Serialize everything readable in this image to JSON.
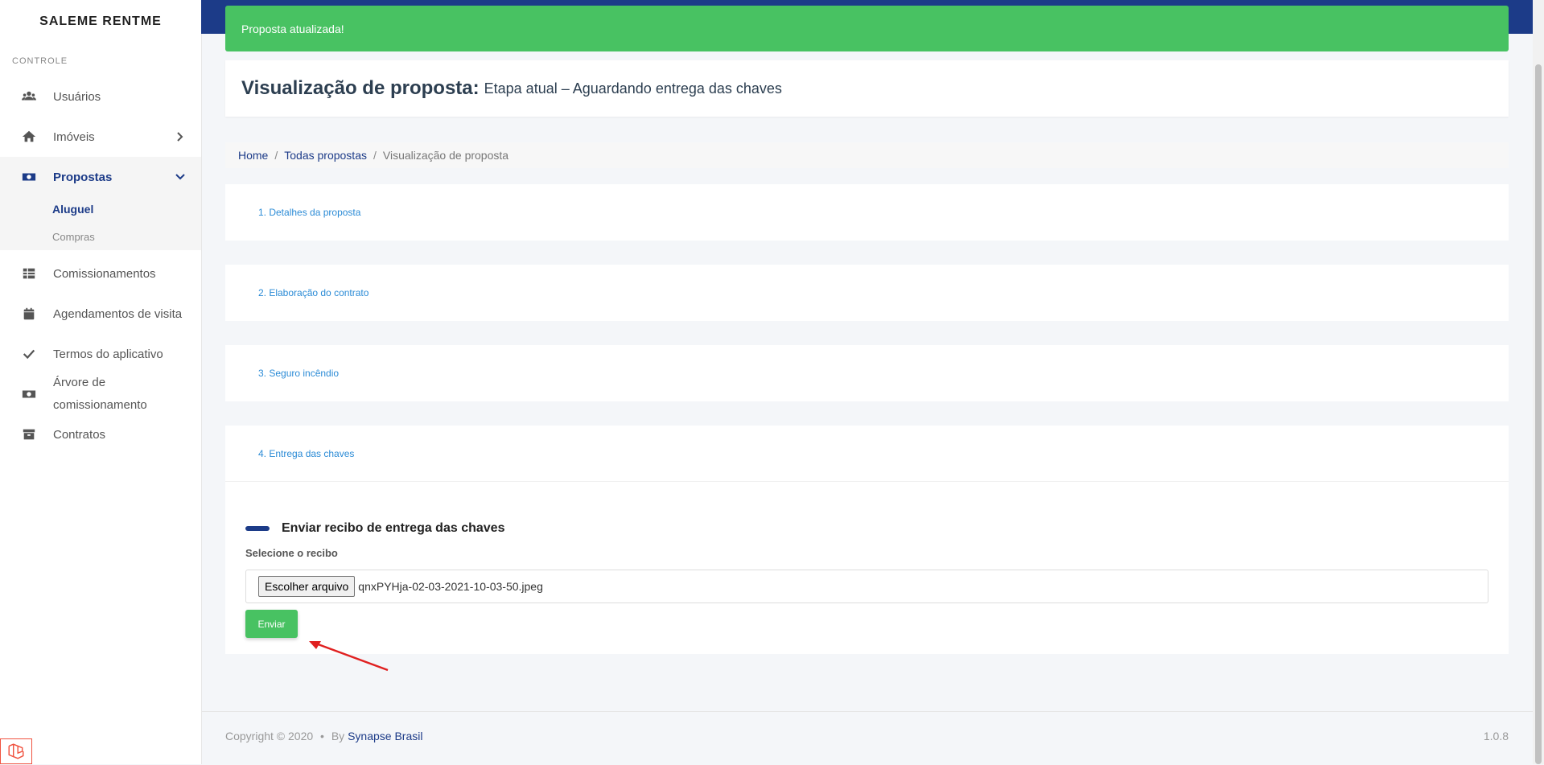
{
  "brand": "SALEME RENTME",
  "sidebar": {
    "section": "CONTROLE",
    "items": [
      {
        "label": "Usuários",
        "icon": "users-icon"
      },
      {
        "label": "Imóveis",
        "icon": "home-icon"
      },
      {
        "label": "Propostas",
        "icon": "money-bill-icon"
      },
      {
        "label": "Comissionamentos",
        "icon": "table-icon"
      },
      {
        "label": "Agendamentos de visita",
        "icon": "calendar-icon"
      },
      {
        "label": "Termos do aplicativo",
        "icon": "check-icon"
      },
      {
        "label_line1": "Árvore de",
        "label_line2": "comissionamento",
        "icon": "money-bill-icon"
      },
      {
        "label": "Contratos",
        "icon": "archive-icon"
      }
    ],
    "sub_items": [
      "Aluguel",
      "Compras"
    ]
  },
  "alert": "Proposta atualizada!",
  "page": {
    "title": "Visualização de proposta:",
    "subtitle": "Etapa atual – Aguardando entrega das chaves"
  },
  "breadcrumb": [
    "Home",
    "Todas propostas",
    "Visualização de proposta"
  ],
  "steps": [
    "1. Detalhes da proposta",
    "2. Elaboração do contrato",
    "3. Seguro incêndio",
    "4. Entrega das chaves"
  ],
  "form": {
    "heading": "Enviar recibo de entrega das chaves",
    "label": "Selecione o recibo",
    "file_button": "Escolher arquivo",
    "file_name": "qnxPYHja-02-03-2021-10-03-50.jpeg",
    "submit": "Enviar"
  },
  "footer": {
    "copyright": "Copyright © 2020",
    "bullet": "•",
    "by": "By",
    "company": "Synapse Brasil",
    "version": "1.0.8"
  },
  "colors": {
    "primary": "#1c3b88",
    "success": "#48c262",
    "link": "#2b8bd6"
  }
}
